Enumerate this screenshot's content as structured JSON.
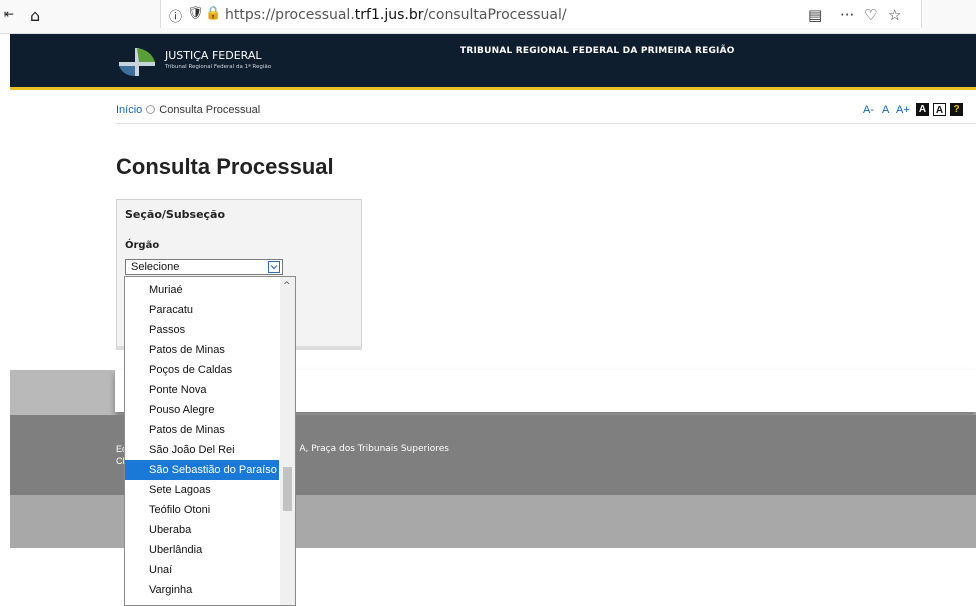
{
  "browser": {
    "url_prefix": "https://processual.",
    "url_domain": "trf1.jus.br",
    "url_path": "/consultaProcessual/",
    "info_icon": "ⓘ",
    "shield_icon": "🛡",
    "lock_icon": "🔒",
    "home_icon": "⌂",
    "back_icon": "⇤",
    "reader_icon": "▤",
    "menu_icon": "···",
    "pocket_icon": "♡",
    "bookmark_icon": "☆"
  },
  "header": {
    "logo_title": "JUSTIÇA FEDERAL",
    "logo_subtitle": "Tribunal Regional Federal da 1ª Região",
    "court_title": "TRIBUNAL REGIONAL FEDERAL DA PRIMEIRA REGIÃO"
  },
  "breadcrumb": {
    "home": "Início",
    "current": "Consulta Processual"
  },
  "accessibility": {
    "decrease": "A-",
    "normal": "A",
    "increase": "A+",
    "contrast_dark": "A",
    "contrast_light": "A",
    "help": "?"
  },
  "page": {
    "title": "Consulta Processual"
  },
  "form": {
    "section_title": "Seção/Subseção",
    "orgao_label": "Órgão",
    "select_value": "Selecione"
  },
  "dropdown": {
    "options": [
      "Muriaé",
      "Paracatu",
      "Passos",
      "Patos de Minas",
      "Poços de Caldas",
      "Ponte Nova",
      "Pouso Alegre",
      "Patos de Minas",
      "São João Del Rei",
      "São Sebastião do Paraíso",
      "Sete Lagoas",
      "Teófilo Otoni",
      "Uberaba",
      "Uberlândia",
      "Unaí",
      "Varginha"
    ],
    "selected_index": 9
  },
  "footer": {
    "line1_prefix": "Ed",
    "line1_text": "co A, Praça dos Tribunais Superiores",
    "line2_prefix": "CE"
  },
  "colors": {
    "header_bg": "#0f1e2e",
    "header_border": "#e8c226",
    "link": "#1166bb",
    "selected_option": "#1a78d6"
  }
}
